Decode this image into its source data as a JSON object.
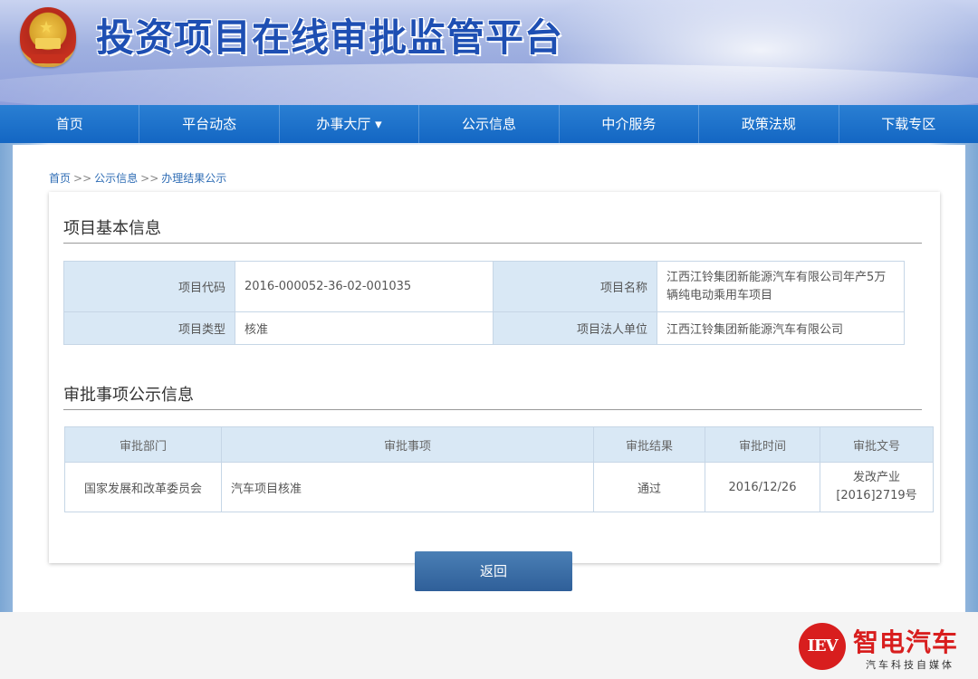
{
  "header": {
    "site_title": "投资项目在线审批监管平台"
  },
  "nav": {
    "items": [
      "首页",
      "平台动态",
      "办事大厅 ▾",
      "公示信息",
      "中介服务",
      "政策法规",
      "下载专区"
    ]
  },
  "breadcrumb": {
    "items": [
      "首页",
      "公示信息",
      "办理结果公示"
    ],
    "separator": ">>"
  },
  "basic_info": {
    "title": "项目基本信息",
    "project_code_label": "项目代码",
    "project_code": "2016-000052-36-02-001035",
    "project_name_label": "项目名称",
    "project_name": "江西江铃集团新能源汽车有限公司年产5万辆纯电动乘用车项目",
    "project_type_label": "项目类型",
    "project_type": "核准",
    "legal_entity_label": "项目法人单位",
    "legal_entity": "江西江铃集团新能源汽车有限公司"
  },
  "approval": {
    "title": "审批事项公示信息",
    "columns": [
      "审批部门",
      "审批事项",
      "审批结果",
      "审批时间",
      "审批文号"
    ],
    "rows": [
      [
        "国家发展和改革委员会",
        "汽车项目核准",
        "通过",
        "2016/12/26",
        "发改产业[2016]2719号"
      ]
    ]
  },
  "return_button": "返回",
  "watermark": {
    "logo_text": "IEV",
    "name": "智电汽车",
    "subtitle": "汽车科技自媒体"
  },
  "colors": {
    "nav_bg": "#1a6fc9",
    "title_blue": "#1e4fb3",
    "label_cell_bg": "#d9e8f5",
    "button_bg": "#3a6ea8",
    "brand_red": "#d81e1e"
  }
}
